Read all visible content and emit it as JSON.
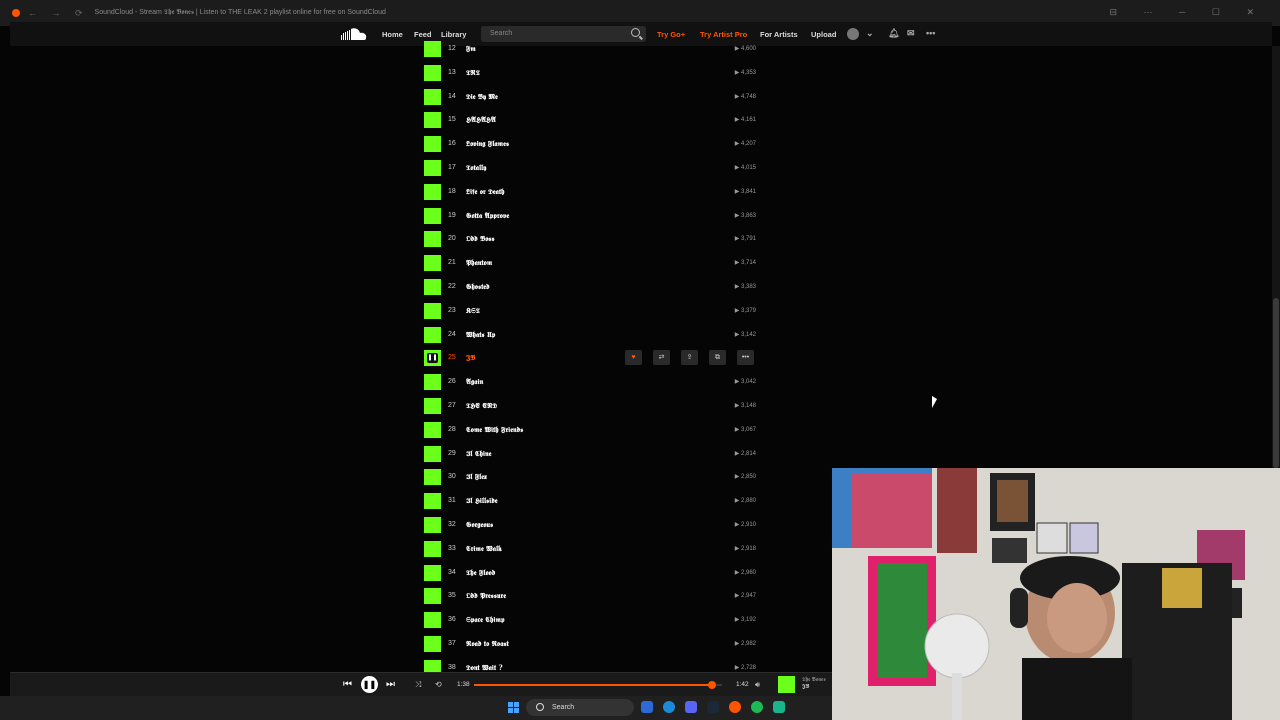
{
  "browser": {
    "tab_title": "SoundCloud - Stream 𝕿𝖍𝖊 𝕭𝖔𝖓𝖊𝖘 | Listen to THE LEAK 2 playlist online for free on SoundCloud",
    "nav_glyphs": "← → ⟳",
    "window_controls": "⊟ ⋯ ─ ☐ ✕"
  },
  "header": {
    "nav": {
      "home": "Home",
      "feed": "Feed",
      "library": "Library"
    },
    "search": {
      "placeholder": "Search"
    },
    "try_go": "Try Go+",
    "try_artist_pro": "Try Artist Pro",
    "for_artists": "For Artists",
    "upload": "Upload",
    "more": "•••"
  },
  "tracks": [
    {
      "num": "12",
      "title": "𝕱𝖒",
      "plays": "4,600"
    },
    {
      "num": "13",
      "title": "𝕿𝕽𝕿",
      "plays": "4,353"
    },
    {
      "num": "14",
      "title": "𝕯𝖎𝖊 𝕭𝖞 𝕸𝖊",
      "plays": "4,748"
    },
    {
      "num": "15",
      "title": "𝕳𝕬𝕳𝕬𝕳𝕬",
      "plays": "4,161"
    },
    {
      "num": "16",
      "title": "𝕷𝖔𝖛𝖎𝖓𝖌 𝕱𝖑𝖆𝖒𝖊𝖘",
      "plays": "4,207"
    },
    {
      "num": "17",
      "title": "𝕿𝖔𝖙𝖆𝖑𝖑𝖞",
      "plays": "4,015"
    },
    {
      "num": "18",
      "title": "𝕷𝖎𝖋𝖊 𝖔𝖗 𝕯𝖊𝖆𝖙𝖍",
      "plays": "3,841"
    },
    {
      "num": "19",
      "title": "𝕲𝖔𝖙𝖙𝖆 𝕬𝖕𝖕𝖗𝖔𝖛𝖊",
      "plays": "3,863"
    },
    {
      "num": "20",
      "title": "𝕺𝖉𝖉 𝕭𝖔𝖘𝖘",
      "plays": "3,791"
    },
    {
      "num": "21",
      "title": "𝕻𝖍𝖆𝖓𝖙𝖔𝖒",
      "plays": "3,714"
    },
    {
      "num": "22",
      "title": "𝕲𝖍𝖔𝖘𝖙𝖊𝖉",
      "plays": "3,383"
    },
    {
      "num": "23",
      "title": "𝕶𝕾𝕿",
      "plays": "3,379"
    },
    {
      "num": "24",
      "title": "𝖂𝖍𝖆𝖙𝖘 𝖀𝖕",
      "plays": "3,142"
    },
    {
      "num": "25",
      "title": "𝕵𝕭",
      "plays": "",
      "active": true
    },
    {
      "num": "26",
      "title": "𝕬𝖌𝖆𝖎𝖓",
      "plays": "3,042"
    },
    {
      "num": "27",
      "title": "𝕿𝕳𝕰 𝕰𝕹𝕯",
      "plays": "3,148"
    },
    {
      "num": "28",
      "title": "𝕮𝖔𝖒𝖊 𝖂𝖎𝖙𝖍 𝕱𝖗𝖎𝖊𝖓𝖉𝖘",
      "plays": "3,067"
    },
    {
      "num": "29",
      "title": "𝕴𝖑 𝕮𝖍𝖎𝖓𝖊",
      "plays": "2,814"
    },
    {
      "num": "30",
      "title": "𝕴𝖑 𝕱𝖑𝖊𝖝",
      "plays": "2,850"
    },
    {
      "num": "31",
      "title": "𝕴𝖑 𝕳𝖎𝖑𝖑𝖘𝖎𝖉𝖊",
      "plays": "2,880"
    },
    {
      "num": "32",
      "title": "𝕲𝖔𝖗𝖌𝖊𝖔𝖚𝖘",
      "plays": "2,910"
    },
    {
      "num": "33",
      "title": "𝕮𝖗𝖎𝖒𝖊 𝖂𝖆𝖑𝖐",
      "plays": "2,918"
    },
    {
      "num": "34",
      "title": "𝕿𝖍𝖊 𝕱𝖑𝖔𝖔𝖉",
      "plays": "2,960"
    },
    {
      "num": "35",
      "title": "𝕺𝖉𝖉 𝕻𝖗𝖊𝖘𝖘𝖚𝖗𝖊",
      "plays": "2,947"
    },
    {
      "num": "36",
      "title": "𝕾𝖕𝖆𝖈𝖊 𝕮𝖍𝖎𝖒𝖕",
      "plays": "3,192"
    },
    {
      "num": "37",
      "title": "𝕽𝖔𝖆𝖉 𝖙𝖔 𝕽𝖔𝖆𝖘𝖙",
      "plays": "2,982"
    },
    {
      "num": "38",
      "title": "𝕯𝖔𝖓𝖙 𝖂𝖆𝖎𝖙 ?",
      "plays": "2,728"
    }
  ],
  "active_actions": [
    "♥",
    "⇄",
    "⇪",
    "⧉",
    "•••"
  ],
  "player": {
    "elapsed": "1:38",
    "duration": "1:42",
    "progress_fraction": 0.96,
    "now_playing_artist": "𝕿𝖍𝖊 𝕭𝖔𝖓𝖊𝖘",
    "now_playing_title": "𝕵𝕭"
  },
  "taskbar": {
    "search_label": "Search"
  },
  "colors": {
    "accent": "#ff5500",
    "artwork": "#6cff1c"
  }
}
